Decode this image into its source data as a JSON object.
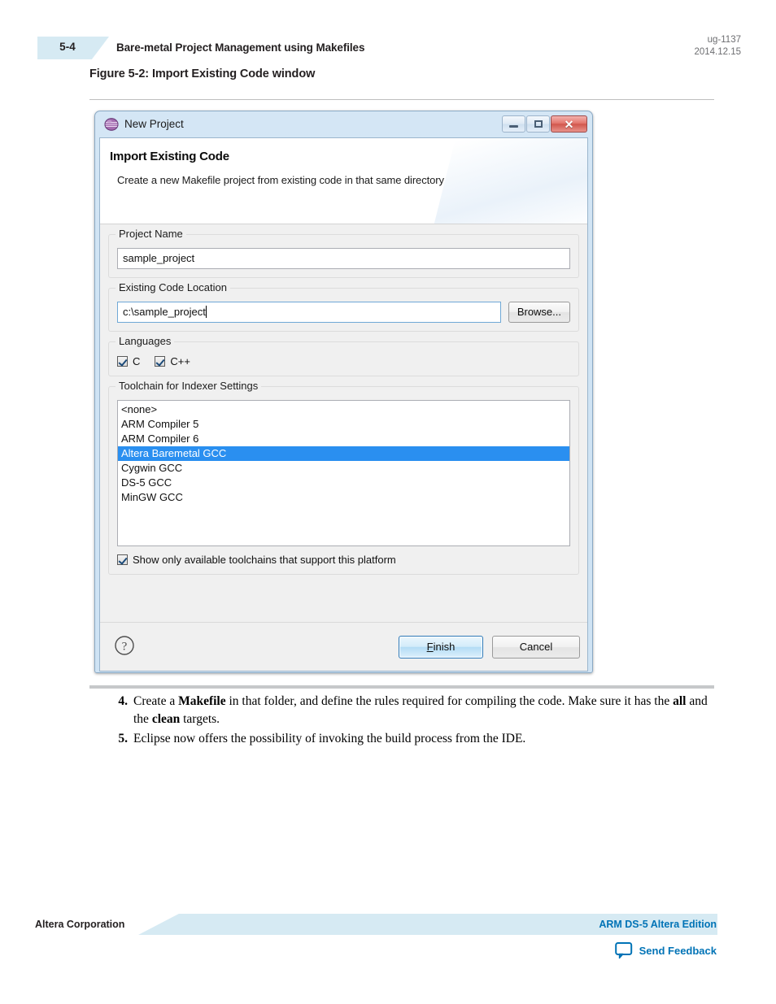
{
  "page": {
    "number": "5-4",
    "header_title": "Bare-metal Project Management using Makefiles",
    "doc_id": "ug-1137",
    "doc_date": "2014.12.15",
    "figure_caption": "Figure 5-2: Import Existing Code window"
  },
  "dialog": {
    "window_title": "New Project",
    "icon": "eclipse-new-project-icon",
    "window_buttons": {
      "minimize": "minimize-icon",
      "maximize": "maximize-icon",
      "close": "✕"
    },
    "wizard": {
      "title": "Import Existing Code",
      "description": "Create a new Makefile project from existing code in that same directory"
    },
    "project_name": {
      "label": "Project Name",
      "value": "sample_project"
    },
    "existing_code_location": {
      "label": "Existing Code Location",
      "value": "c:\\sample_project",
      "browse_label": "Browse..."
    },
    "languages": {
      "label": "Languages",
      "options": [
        {
          "label": "C",
          "checked": true
        },
        {
          "label": "C++",
          "checked": true
        }
      ]
    },
    "toolchain": {
      "label": "Toolchain for Indexer Settings",
      "items": [
        "<none>",
        "ARM Compiler 5",
        "ARM Compiler 6",
        "Altera Baremetal GCC",
        "Cygwin GCC",
        "DS-5 GCC",
        "MinGW GCC"
      ],
      "selected_index": 3,
      "show_only_available": {
        "label": "Show only available toolchains that support this platform",
        "checked": true
      }
    },
    "buttons": {
      "help": "?",
      "finish_mnemonic": "F",
      "finish_rest": "inish",
      "cancel": "Cancel"
    },
    "colors": {
      "selection_blue": "#2a8ff0",
      "frame_blue": "#cfe3f4",
      "close_red": "#d1574d"
    }
  },
  "steps": [
    {
      "number": "4.",
      "parts": [
        {
          "t": "Create a ",
          "b": false
        },
        {
          "t": "Makefile",
          "b": true
        },
        {
          "t": " in that folder, and define the rules required for compiling the code. Make sure it has the ",
          "b": false
        },
        {
          "t": "all",
          "b": true
        },
        {
          "t": " and the ",
          "b": false
        },
        {
          "t": "clean",
          "b": true
        },
        {
          "t": " targets.",
          "b": false
        }
      ]
    },
    {
      "number": "5.",
      "parts": [
        {
          "t": "Eclipse now offers the possibility of invoking the build process from the IDE.",
          "b": false
        }
      ]
    }
  ],
  "footer": {
    "left": "Altera Corporation",
    "right": "ARM DS-5 Altera Edition",
    "feedback_label": "Send Feedback",
    "feedback_icon": "speech-bubble-icon",
    "link_color": "#0073b6"
  }
}
